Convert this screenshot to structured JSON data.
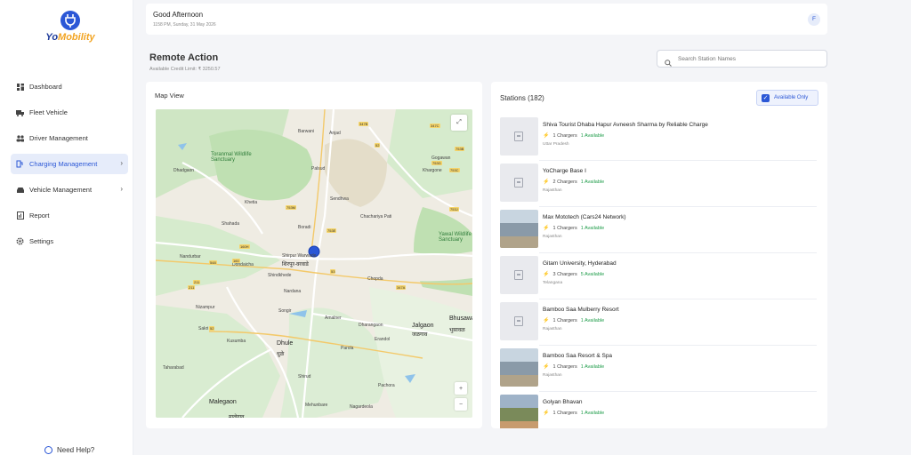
{
  "app": {
    "logo_prefix": "Yo",
    "logo_suffix": "Mobility"
  },
  "sidebar": {
    "items": [
      {
        "label": "Dashboard",
        "icon": "dashboard-icon",
        "active": false,
        "has_chevron": false
      },
      {
        "label": "Fleet Vehicle",
        "icon": "vehicle-icon",
        "active": false,
        "has_chevron": false
      },
      {
        "label": "Driver Management",
        "icon": "users-icon",
        "active": false,
        "has_chevron": false
      },
      {
        "label": "Charging Management",
        "icon": "charging-icon",
        "active": true,
        "has_chevron": true
      },
      {
        "label": "Vehicle Management",
        "icon": "car-icon",
        "active": false,
        "has_chevron": true
      },
      {
        "label": "Report",
        "icon": "report-icon",
        "active": false,
        "has_chevron": false
      },
      {
        "label": "Settings",
        "icon": "gear-icon",
        "active": false,
        "has_chevron": false
      }
    ],
    "help_label": "Need Help?"
  },
  "header": {
    "greeting": "Good Afternoon",
    "datetime": "1158 PM, Sunday, 31 May 2026",
    "avatar_initial": "F"
  },
  "page": {
    "title": "Remote Action",
    "credit": "Available Credit Limit: ₹ 3250.57"
  },
  "search": {
    "placeholder": "Search Station Names"
  },
  "map": {
    "title": "Map View",
    "labels": [
      "Barwani",
      "Anjad",
      "Toranmal Wildlife Sanctuary",
      "Dhadgaon",
      "Palsud",
      "Sendhwa",
      "Khargone",
      "Gogawan",
      "Khetia",
      "Boradi",
      "Chachariya Pati",
      "Shahada",
      "Nandurbar",
      "Dondaicha",
      "Shirpur Warwade",
      "Yawal Wildlife Sanctuary",
      "Shindkhede",
      "Nardana",
      "Chopda",
      "Songir",
      "Amalner",
      "Nizampur",
      "Dharangaon",
      "Jalgaon",
      "Bhusawal",
      "Sakri",
      "Kusumba",
      "Dhule",
      "Parola",
      "Erandol",
      "Taharabad",
      "Shirud",
      "Pachora",
      "Malegaon",
      "Mehunbare",
      "Nagardeola"
    ],
    "local_labels": [
      "शिरपूर-वरवाडे",
      "धुळे",
      "जळगाव",
      "मालेगाव",
      "भुसावळ"
    ],
    "road_labels": [
      "347B",
      "347C",
      "52",
      "753B",
      "753G",
      "753C",
      "753M",
      "753E",
      "753J",
      "160H",
      "160",
      "548",
      "211",
      "347A",
      "53",
      "52",
      "211"
    ]
  },
  "stations": {
    "title": "Stations (182)",
    "filter_label": "Available Only",
    "filter_checked": true,
    "items": [
      {
        "name": "Shiva Tourist Dhaba Hapur Avneesh Sharma by Reliable Charge",
        "chargers": "1 Chargers",
        "available": "1 Available",
        "state": "Uttar Pradesh",
        "image": "placeholder"
      },
      {
        "name": "YoCharge Base I",
        "chargers": "2 Chargers",
        "available": "1 Available",
        "state": "Rajasthan",
        "image": "placeholder"
      },
      {
        "name": "Max Mototech (Cars24 Network)",
        "chargers": "1 Chargers",
        "available": "1 Available",
        "state": "Rajasthan",
        "image": "photo"
      },
      {
        "name": "Gitam University, Hyderabad",
        "chargers": "3 Chargers",
        "available": "5 Available",
        "state": "Telangana",
        "image": "placeholder"
      },
      {
        "name": "Bamboo Saa Mulberry Resort",
        "chargers": "1 Chargers",
        "available": "1 Available",
        "state": "Rajasthan",
        "image": "placeholder"
      },
      {
        "name": "Bamboo Saa Resort & Spa",
        "chargers": "1 Chargers",
        "available": "1 Available",
        "state": "Rajasthan",
        "image": "photo"
      },
      {
        "name": "Golyan Bhavan",
        "chargers": "1 Chargers",
        "available": "1 Available",
        "state": "",
        "image": "photo"
      }
    ]
  },
  "colors": {
    "accent": "#2b57d6",
    "available": "#1f9c4a",
    "brand_orange": "#f2a422"
  }
}
